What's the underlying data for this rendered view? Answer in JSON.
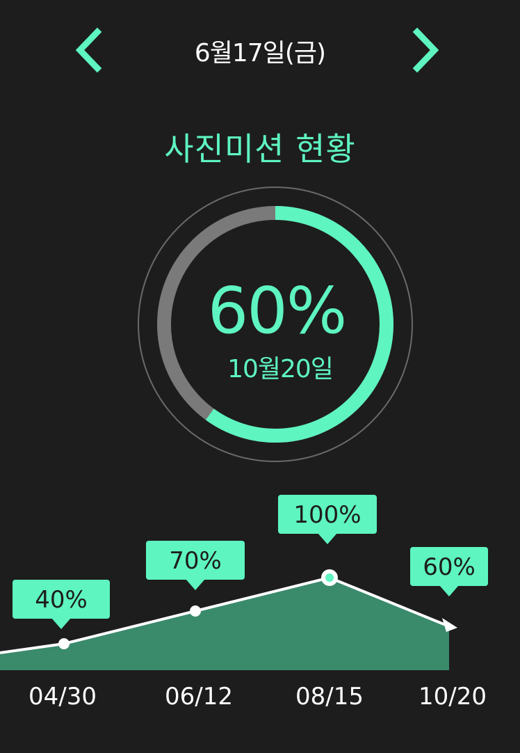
{
  "header": {
    "date": "6월17일(금)",
    "prev_icon": "chevron-left-icon",
    "next_icon": "chevron-right-icon"
  },
  "section": {
    "title": "사진미션 현황"
  },
  "progress": {
    "percent_label": "60%",
    "value": 0.6,
    "date_label": "10월20일"
  },
  "colors": {
    "background": "#1d1d1d",
    "accent": "#5ef5c0",
    "track": "#7a7a7a",
    "area": "#3a8a6c",
    "line": "#ffffff"
  },
  "chart_data": {
    "type": "area",
    "categories": [
      "04/30",
      "06/12",
      "08/15",
      "10/20"
    ],
    "values": [
      40,
      70,
      100,
      60
    ],
    "value_labels": [
      "40%",
      "70%",
      "100%",
      "60%"
    ],
    "highlight_index": 2,
    "ylim": [
      0,
      100
    ],
    "grid": false,
    "legend": "none"
  }
}
